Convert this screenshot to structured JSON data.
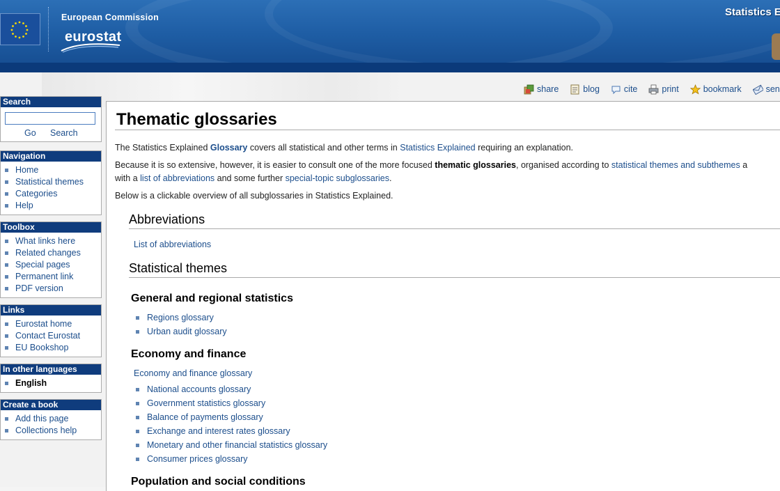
{
  "header": {
    "org": "European Commission",
    "logo_text": "eurostat",
    "site_title": "Statistics E"
  },
  "actions": [
    {
      "label": "share",
      "icon": "share-icon"
    },
    {
      "label": "blog",
      "icon": "blog-icon"
    },
    {
      "label": "cite",
      "icon": "cite-icon"
    },
    {
      "label": "print",
      "icon": "print-icon"
    },
    {
      "label": "bookmark",
      "icon": "bookmark-star-icon"
    },
    {
      "label": "send",
      "icon": "send-icon"
    }
  ],
  "sidebar": {
    "search": {
      "title": "Search",
      "go": "Go",
      "search": "Search",
      "value": ""
    },
    "navigation": {
      "title": "Navigation",
      "items": [
        "Home",
        "Statistical themes",
        "Categories",
        "Help"
      ]
    },
    "toolbox": {
      "title": "Toolbox",
      "items": [
        "What links here",
        "Related changes",
        "Special pages",
        "Permanent link",
        "PDF version"
      ]
    },
    "links": {
      "title": "Links",
      "items": [
        "Eurostat home",
        "Contact Eurostat",
        "EU Bookshop"
      ]
    },
    "languages": {
      "title": "In other languages",
      "items": [
        "English"
      ]
    },
    "book": {
      "title": "Create a book",
      "items": [
        "Add this page",
        "Collections help"
      ]
    }
  },
  "content": {
    "title": "Thematic glossaries",
    "intro1": {
      "t1": "The Statistics Explained ",
      "glossary": "Glossary",
      "t2": " covers all statistical and other terms in ",
      "se": "Statistics Explained",
      "t3": " requiring an explanation."
    },
    "intro2": {
      "t1": "Because it is so extensive, however, it is easier to consult one of the more focused ",
      "bold": "thematic glossaries",
      "t2": ", organised according to ",
      "link": "statistical themes and subthemes",
      "t3": " a"
    },
    "intro3": {
      "t1": "with a ",
      "abbr": "list of abbreviations",
      "t2": " and some further ",
      "special": "special-topic subglossaries",
      "t3": "."
    },
    "intro4": "Below is a clickable overview of all subglossaries in Statistics Explained.",
    "abbr_heading": "Abbreviations",
    "abbr_link": "List of abbreviations",
    "themes_heading": "Statistical themes",
    "general": {
      "title": "General and regional statistics",
      "items": [
        "Regions glossary",
        "Urban audit glossary"
      ]
    },
    "economy": {
      "title": "Economy and finance",
      "main_link": "Economy and finance glossary",
      "items": [
        "National accounts glossary",
        "Government statistics glossary",
        "Balance of payments glossary",
        "Exchange and interest rates glossary",
        "Monetary and other financial statistics glossary",
        "Consumer prices glossary"
      ]
    },
    "population": {
      "title": "Population and social conditions"
    }
  }
}
